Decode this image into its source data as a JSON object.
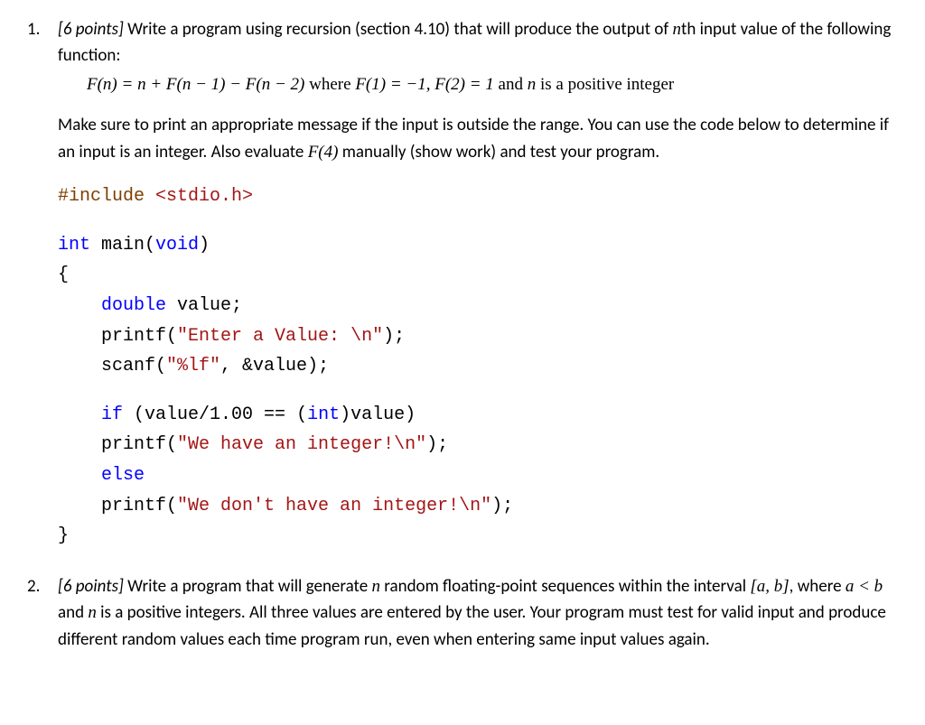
{
  "q1": {
    "number": "1.",
    "points_label": "[6 points]",
    "intro_a": " Write a program using recursion (section 4.10) that will produce the output of ",
    "intro_nth": "n",
    "intro_b": "th input value of the following function:",
    "formula_main": "F(n) = n + F(n − 1) − F(n − 2)",
    "formula_where": " where ",
    "formula_cond1": "F(1) = −1,  F(2) = 1",
    "formula_and": " and  ",
    "formula_nvar": "n",
    "formula_tail": " is a positive integer",
    "para2_a": "Make sure to print an appropriate message if the input is outside the range.  You can use the code below to determine if an input is an integer.  Also evaluate ",
    "para2_f4": "F(4)",
    "para2_b": " manually (show work) and test your program.",
    "code": {
      "l1_a": "#include ",
      "l1_b": "<stdio.h>",
      "l2_a": "int",
      "l2_b": " main(",
      "l2_c": "void",
      "l2_d": ")",
      "l3": "{",
      "l4_a": "    ",
      "l4_b": "double",
      "l4_c": " value;",
      "l5_a": "    printf(",
      "l5_b": "\"Enter a Value: \\n\"",
      "l5_c": ");",
      "l6_a": "    scanf(",
      "l6_b": "\"%lf\"",
      "l6_c": ", &value);",
      "l7_a": "    ",
      "l7_b": "if",
      "l7_c": " (value/1.00 == (",
      "l7_d": "int",
      "l7_e": ")value)",
      "l8_a": "    printf(",
      "l8_b": "\"We have an integer!\\n\"",
      "l8_c": ");",
      "l9_a": "    ",
      "l9_b": "else",
      "l10_a": "    printf(",
      "l10_b": "\"We don't have an integer!\\n\"",
      "l10_c": ");",
      "l11": "}"
    }
  },
  "q2": {
    "number": "2.",
    "points_label": "[6 points]",
    "text_a": " Write a program that will generate ",
    "text_n": "n",
    "text_b": " random floating-point sequences within the interval ",
    "text_interval": "[a, b]",
    "text_c": ", where ",
    "text_ineq": "a <  b ",
    "text_d": " and ",
    "text_n2": "n",
    "text_e": " is a positive integers.  All three values are entered by the user.  Your program must test for valid input and produce different random values each time program run, even when entering same input values again."
  }
}
